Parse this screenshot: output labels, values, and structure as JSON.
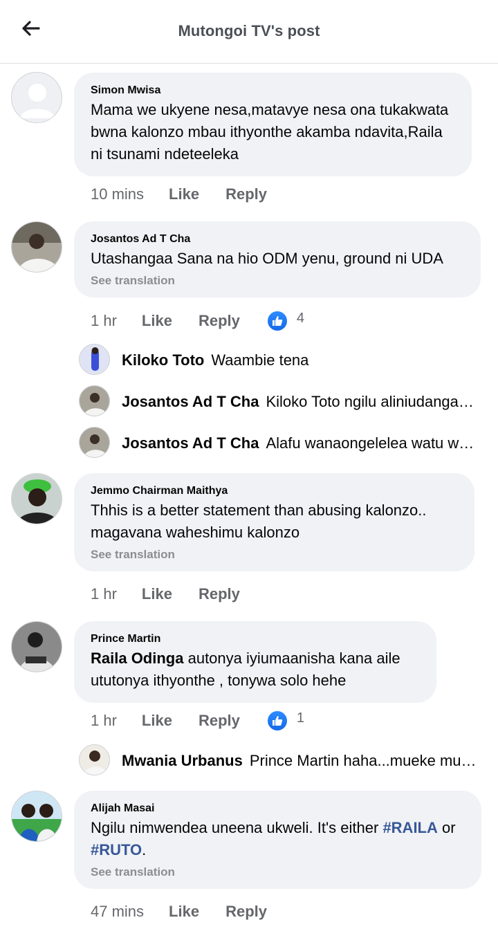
{
  "header": {
    "title": "Mutongoi TV's post"
  },
  "actions": {
    "like": "Like",
    "reply": "Reply",
    "see_translation": "See translation"
  },
  "comments": [
    {
      "author": "Simon Mwisa",
      "text": "Mama we ukyene nesa,matavye nesa ona tukakwata bwna kalonzo mbau ithyonthe akamba ndavita,Raila ni tsunami ndeteeleka",
      "time": "10 mins"
    },
    {
      "author": "Josantos Ad T Cha",
      "text": "Utashangaa Sana na hio ODM yenu, ground ni UDA",
      "time": "1 hr",
      "likes": "4",
      "replies": [
        {
          "author": "Kiloko Toto",
          "text": "Waambie tena"
        },
        {
          "author": "Josantos Ad T Cha",
          "text": "Kiloko Toto ngilu aliniudanganya ithyonthe"
        },
        {
          "author": "Josantos Ad T Cha",
          "text": "Alafu wanaongelelea watu wengine"
        }
      ]
    },
    {
      "author": "Jemmo Chairman Maithya",
      "text": "Thhis is a better statement than abusing kalonzo.. magavana waheshimu kalonzo",
      "time": "1 hr"
    },
    {
      "author": "Prince Martin",
      "mention": "Raila Odinga",
      "text": " autonya iyiumaanisha kana aile ututonya ithyonthe , tonywa solo hehe",
      "time": "1 hr",
      "likes": "1",
      "replies": [
        {
          "author": "Mwania Urbanus",
          "text": "Prince Martin haha...mueke mutonye"
        }
      ]
    },
    {
      "author": "Alijah Masai",
      "text_a": "Ngilu nimwendea uneena ukweli. It's either ",
      "hashtag_1": "#RAILA",
      "text_b": " or ",
      "hashtag_2": "#RUTO",
      "text_c": ".",
      "time": "47 mins"
    }
  ]
}
